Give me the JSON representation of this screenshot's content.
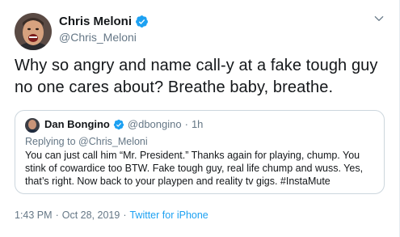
{
  "tweet": {
    "author_name": "Chris Meloni",
    "author_handle": "@Chris_Meloni",
    "text": "Why so angry and name call-y at a fake tough guy no one cares about? Breathe baby, breathe.",
    "time": "1:43 PM",
    "date_separator": "·",
    "date": "Oct 28, 2019",
    "source_separator": "·",
    "source": "Twitter for iPhone"
  },
  "quoted": {
    "author_name": "Dan Bongino",
    "author_handle": "@dbongino",
    "separator": "·",
    "age": "1h",
    "reply_prefix": "Replying to",
    "reply_to": "@Chris_Meloni",
    "text": "You can just call him “Mr. President.” Thanks again for playing, chump. You stink of cowardice too BTW. Fake tough guy, real life chump and wuss. Yes, that’s right. Now back to your playpen and reality tv gigs. #InstaMute"
  },
  "icons": {
    "verified": "verified-badge-icon",
    "caret": "chevron-down-icon"
  },
  "colors": {
    "verified": "#1da1f2",
    "link": "#1da1f2",
    "secondary_text": "#657786",
    "border": "#ccd6dd"
  }
}
